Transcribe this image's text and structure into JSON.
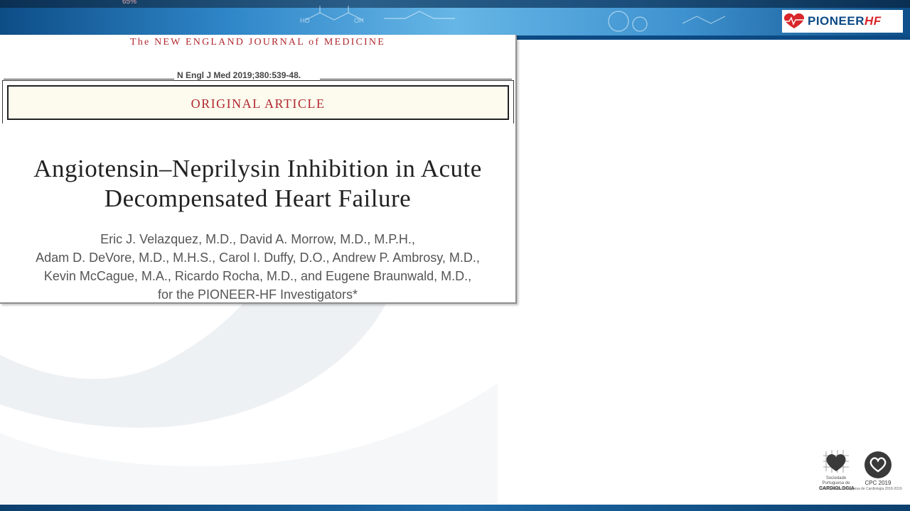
{
  "banner": {
    "percent_text": "65%",
    "logo_text_main": "PIONEER",
    "logo_text_accent": "HF",
    "colors": {
      "banner_blue": "#2f86c8",
      "logo_red": "#d8262a",
      "logo_blue": "#0c4a84"
    }
  },
  "article": {
    "journal_name": "The NEW ENGLAND JOURNAL of MEDICINE",
    "citation": "N Engl J Med 2019;380:539-48.",
    "section_label": "ORIGINAL ARTICLE",
    "title_lines": [
      "Angiotensin–Neprilysin Inhibition in Acute",
      "Decompensated Heart Failure"
    ],
    "author_lines": [
      "Eric J. Velazquez, M.D., David A. Morrow, M.D., M.P.H.,",
      "Adam D. DeVore, M.D., M.H.S., Carol I. Duffy, D.O., Andrew P. Ambrosy, M.D.,",
      "Kevin McCague, M.A., Ricardo Rocha, M.D., and Eugene Braunwald, M.D.,",
      "for the PIONEER-HF Investigators*"
    ],
    "colors": {
      "journal_red": "#b0282f",
      "section_bg": "#fdfaee"
    }
  },
  "footer": {
    "spc_org_small": "Sociedade Portuguesa de",
    "spc_org_name": "CARDIOLOGIA",
    "cpc_label": "CPC 2019",
    "society_note": "© Sociedade Portuguesa de Cardiologia 2018-2019"
  }
}
